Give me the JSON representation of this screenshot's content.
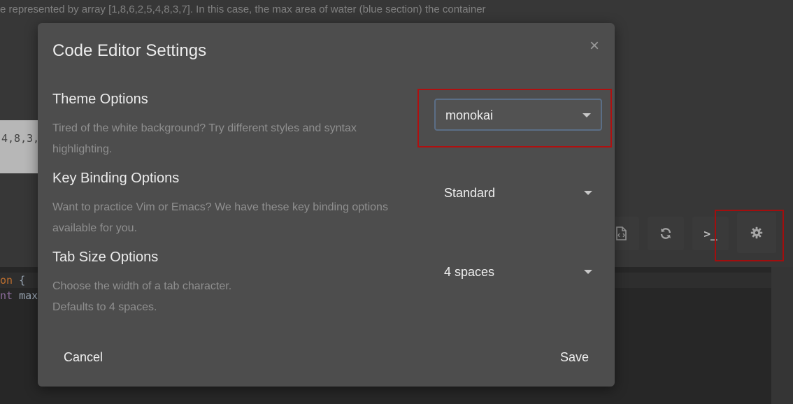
{
  "background": {
    "description": "e represented by array [1,8,6,2,5,4,8,3,7]. In this case, the max area of water (blue section) the container",
    "example_snippet": "4,8,3,",
    "editor_lines": [
      {
        "kw": "on",
        "rest": " {"
      },
      {
        "kw": "nt",
        "rest": " max"
      }
    ],
    "toolbar": {
      "code_icon": "code-file-icon",
      "reset_icon": "refresh-icon",
      "console_label": ">_",
      "settings_icon": "gear-icon"
    }
  },
  "modal": {
    "title": "Code Editor Settings",
    "close_label": "×",
    "options": {
      "theme": {
        "title": "Theme Options",
        "description": "Tired of the white background? Try different styles and syntax highlighting.",
        "selected": "monokai"
      },
      "keybinding": {
        "title": "Key Binding Options",
        "description": "Want to practice Vim or Emacs? We have these key binding options available for you.",
        "selected": "Standard"
      },
      "tabsize": {
        "title": "Tab Size Options",
        "description_line1": "Choose the width of a tab character.",
        "description_line2": "Defaults to 4 spaces.",
        "selected": "4 spaces"
      }
    },
    "buttons": {
      "cancel": "Cancel",
      "save": "Save"
    }
  },
  "colors": {
    "highlight": "#b01010",
    "modal_bg": "#4d4d4d",
    "page_bg": "#3c3c3c"
  }
}
